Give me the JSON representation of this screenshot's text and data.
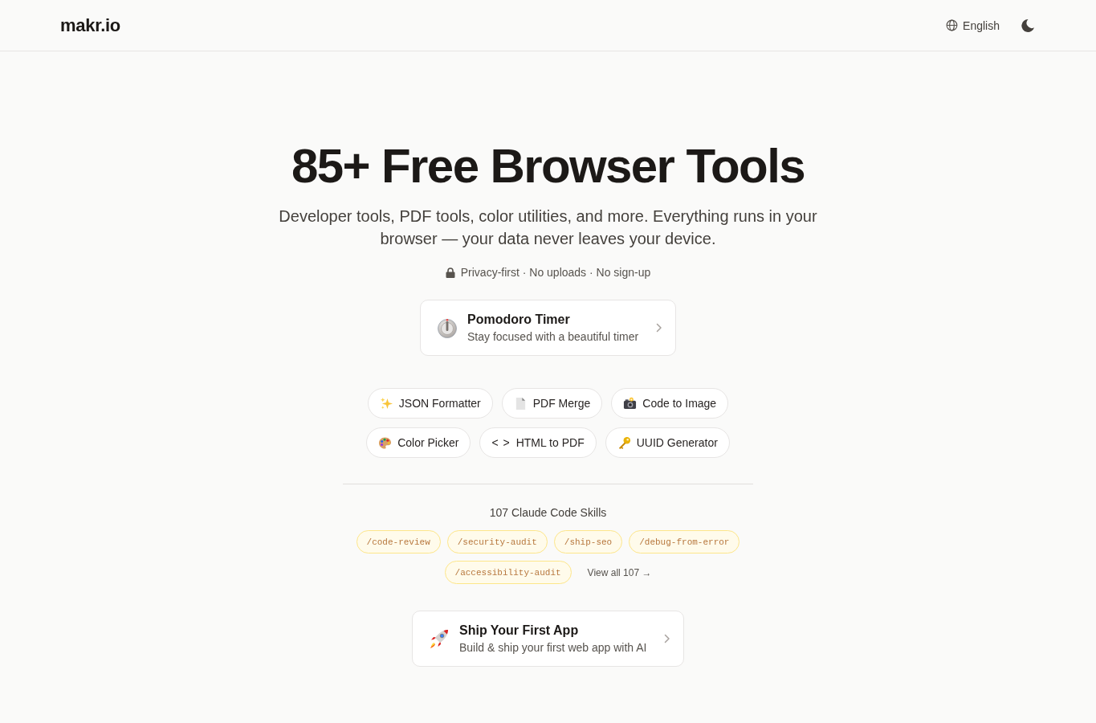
{
  "header": {
    "logo": "makr.io",
    "language": "English"
  },
  "hero": {
    "title": "85+ Free Browser Tools",
    "subtitle": "Developer tools, PDF tools, color utilities, and more. Everything runs in your browser — your data never leaves your device.",
    "privacy": "Privacy-first · No uploads · No sign-up"
  },
  "featured": {
    "title": "Pomodoro Timer",
    "subtitle": "Stay focused with a beautiful timer"
  },
  "tools": [
    {
      "label": "JSON Formatter",
      "kind": "sparkles"
    },
    {
      "label": "PDF Merge",
      "kind": "document"
    },
    {
      "label": "Code to Image",
      "kind": "camera"
    },
    {
      "label": "Color Picker",
      "kind": "palette"
    },
    {
      "label": "HTML to PDF",
      "kind": "glyph",
      "glyph": "< >"
    },
    {
      "label": "UUID Generator",
      "kind": "key"
    }
  ],
  "skills": {
    "heading": "107 Claude Code Skills",
    "tags": [
      "/code-review",
      "/security-audit",
      "/ship-seo",
      "/debug-from-error",
      "/accessibility-audit"
    ],
    "view_all": "View all 107 →"
  },
  "promo": {
    "title": "Ship Your First App",
    "subtitle": "Build & ship your first web app with AI"
  }
}
